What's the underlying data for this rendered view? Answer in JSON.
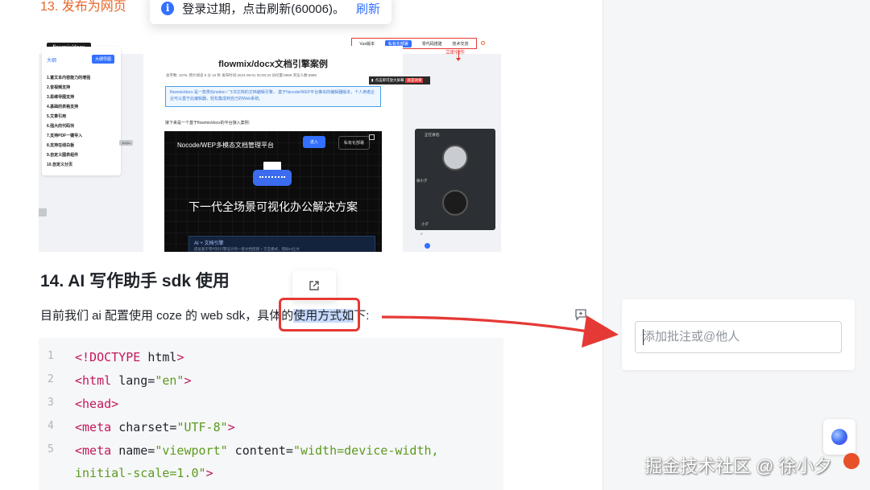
{
  "doc": {
    "section13": "13. 发布为网页",
    "heading14": "14. AI 写作助手 sdk 使用",
    "para_before": "目前我们 ai 配置使用 coze 的 web  sdk，具体的",
    "para_highlight": "使用方式如",
    "para_after": "下:"
  },
  "toast": {
    "icon": "info-icon",
    "message": "登录过期，点击刷新(60006)。",
    "action": "刷新"
  },
  "embedded": {
    "logo": "flowmix/docx",
    "nav": [
      "Vue版本",
      "私有化部署",
      "零代码搭建",
      "技术交流"
    ],
    "create": "立即创作",
    "toc_title": "大纲",
    "toc_button": "大纲导图",
    "toc_items": [
      "1.富文本内容能力的增强",
      "2.音视频支持",
      "3.思维导图支持",
      "4.基础的表格支持",
      "5.文章引用",
      "6.强大的代码块",
      "7.支持PDF一键导入",
      "8.支持在线白板",
      "9.自定义图表组件",
      "10.自定义分页"
    ],
    "card_title": "flowmix/docx文档引擎案例",
    "card_meta": "总字数: 1076, 预计阅读 5 分 34 秒 发布时间:2024-08-01 00:00:34  访问量:9999  浏览人数:6888",
    "card_info": "flowmix/docx 是一款类似notion / 飞书文档的文档编辑引擎。 基于Nocode/WEP平台推出的编辑器版本，个人用者企业可以基于此编辑器，轻松集成到自己的Web系统。",
    "card_line": "接下来是一个基于flowmix/docx的平台接入案例:",
    "dark_title": "Nocode/WEP多模态文档管理平台",
    "dark_btn1": "进入",
    "dark_btn2": "私有化部署",
    "dark_headline": "下一代全场景可视化办公解决方案",
    "dark_card_title": "AI + 文档引擎",
    "dark_card_sub": "底层基于零代码引擎设计的一套文档搭建 + 交互模式，借助AI让文",
    "side_label": "@kjks",
    "tip_text": "点击即可放大屏幕",
    "tip_badge": "就是效果",
    "video_title": "正在讲话:",
    "video_name1": "徐小夕",
    "video_name2": "小夕"
  },
  "code": {
    "lines": [
      {
        "n": "1",
        "parts": [
          {
            "c": "tg",
            "t": "<!DOCTYPE "
          },
          {
            "c": "at",
            "t": "html"
          },
          {
            "c": "tg",
            "t": ">"
          }
        ]
      },
      {
        "n": "2",
        "parts": [
          {
            "c": "tg",
            "t": "<html "
          },
          {
            "c": "at",
            "t": "lang="
          },
          {
            "c": "st",
            "t": "\"en\""
          },
          {
            "c": "tg",
            "t": ">"
          }
        ]
      },
      {
        "n": "3",
        "parts": [
          {
            "c": "tg",
            "t": "<head>"
          }
        ]
      },
      {
        "n": "4",
        "parts": [
          {
            "c": "at",
            "t": "    "
          },
          {
            "c": "tg",
            "t": "<meta "
          },
          {
            "c": "at",
            "t": "charset="
          },
          {
            "c": "st",
            "t": "\"UTF-8\""
          },
          {
            "c": "tg",
            "t": ">"
          }
        ]
      },
      {
        "n": "5",
        "parts": [
          {
            "c": "at",
            "t": "    "
          },
          {
            "c": "tg",
            "t": "<meta "
          },
          {
            "c": "at",
            "t": "name="
          },
          {
            "c": "st",
            "t": "\"viewport\""
          },
          {
            "c": "at",
            "t": " content="
          },
          {
            "c": "st",
            "t": "\"width=device-width,"
          }
        ]
      },
      {
        "n": "",
        "parts": [
          {
            "c": "st",
            "t": "initial-scale=1.0\""
          },
          {
            "c": "tg",
            "t": ">"
          }
        ]
      }
    ]
  },
  "comment": {
    "placeholder": "添加批注或@他人"
  },
  "watermark": "掘金技术社区 @ 徐小夕",
  "colors": {
    "accent": "#3370ff",
    "annotation_red": "#e53935",
    "highlight": "#c7dbff"
  }
}
